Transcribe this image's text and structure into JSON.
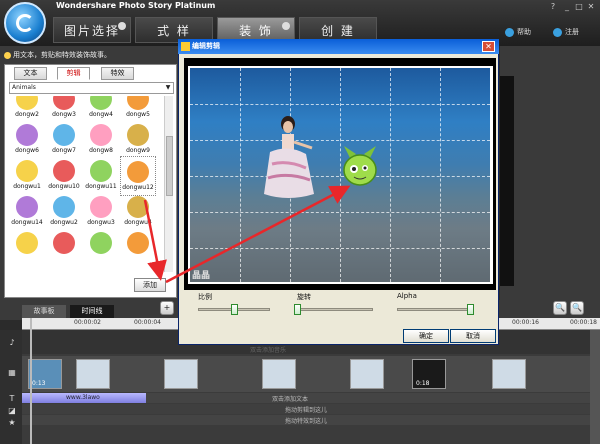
{
  "app": {
    "title": "Wondershare Photo Story Platinum"
  },
  "nav": {
    "tabs": [
      {
        "label": "图片选择",
        "active": false
      },
      {
        "label": "式 样",
        "active": false
      },
      {
        "label": "装 饰",
        "active": true
      },
      {
        "label": "创 建",
        "active": false
      }
    ],
    "help": "帮助",
    "register": "注册"
  },
  "left_panel": {
    "hint": "用文本，剪贴和特效装饰故事。",
    "tabs": [
      {
        "label": "文本",
        "active": false
      },
      {
        "label": "剪辑",
        "active": true
      },
      {
        "label": "特效",
        "active": false
      }
    ],
    "category": "Animals",
    "items": [
      {
        "label": "dongw2",
        "icon": "clipart-partial"
      },
      {
        "label": "dongw3",
        "icon": "clipart-partial"
      },
      {
        "label": "dongw4",
        "icon": "clipart-partial"
      },
      {
        "label": "dongw5",
        "icon": "clipart-partial"
      },
      {
        "label": "dongw6",
        "icon": "duck-clipart"
      },
      {
        "label": "dongw7",
        "icon": "bird-clipart"
      },
      {
        "label": "dongw8",
        "icon": "chicken-clipart"
      },
      {
        "label": "dongw9",
        "icon": "fish-clipart"
      },
      {
        "label": "dongwu1",
        "icon": "pig-clipart"
      },
      {
        "label": "dongwu10",
        "icon": "crown-clipart"
      },
      {
        "label": "dongwu11",
        "icon": "frog-clipart"
      },
      {
        "label": "dongwu12",
        "icon": "green-creature-clipart",
        "selected": true
      },
      {
        "label": "dongwu14",
        "icon": "dog-clipart"
      },
      {
        "label": "dongwu2",
        "icon": "butterfly-clipart"
      },
      {
        "label": "dongwu3",
        "icon": "sun-clipart"
      },
      {
        "label": "dongwu4",
        "icon": "penguin-clipart"
      },
      {
        "label": "",
        "icon": "clipart-partial"
      },
      {
        "label": "",
        "icon": "clipart-partial"
      },
      {
        "label": "",
        "icon": "clipart-partial"
      },
      {
        "label": "",
        "icon": "clipart-partial"
      }
    ],
    "add_button": "添加"
  },
  "dialog": {
    "title": "编辑剪辑",
    "watermark": "晶晶",
    "sliders": [
      {
        "label": "比例",
        "value": 0.5
      },
      {
        "label": "旋转",
        "value": 0.0
      },
      {
        "label": "Alpha",
        "value": 1.0
      }
    ],
    "ok": "确定",
    "cancel": "取消"
  },
  "bottom": {
    "tabs": [
      {
        "label": "故事板",
        "active": false
      },
      {
        "label": "时间线",
        "active": true
      }
    ],
    "ruler_ticks": [
      "00:00:02",
      "00:00:04",
      "00:00:16",
      "00:00:18"
    ],
    "audio_hint": "双击添加音乐",
    "clips": [
      {
        "time": "0:13"
      },
      {
        "time": ""
      },
      {
        "time": ""
      },
      {
        "time": ""
      },
      {
        "time": ""
      },
      {
        "time": "0:18"
      },
      {
        "time": ""
      }
    ],
    "text_clip": "www.3lawo",
    "tracks": [
      "双击添加文本",
      "拖动剪辑到这儿",
      "拖动特效到这儿"
    ]
  },
  "colors": {
    "accent_red": "#e8272a",
    "title_bar": "#0a5fd8",
    "slider_knob": "#2e8b2e"
  }
}
